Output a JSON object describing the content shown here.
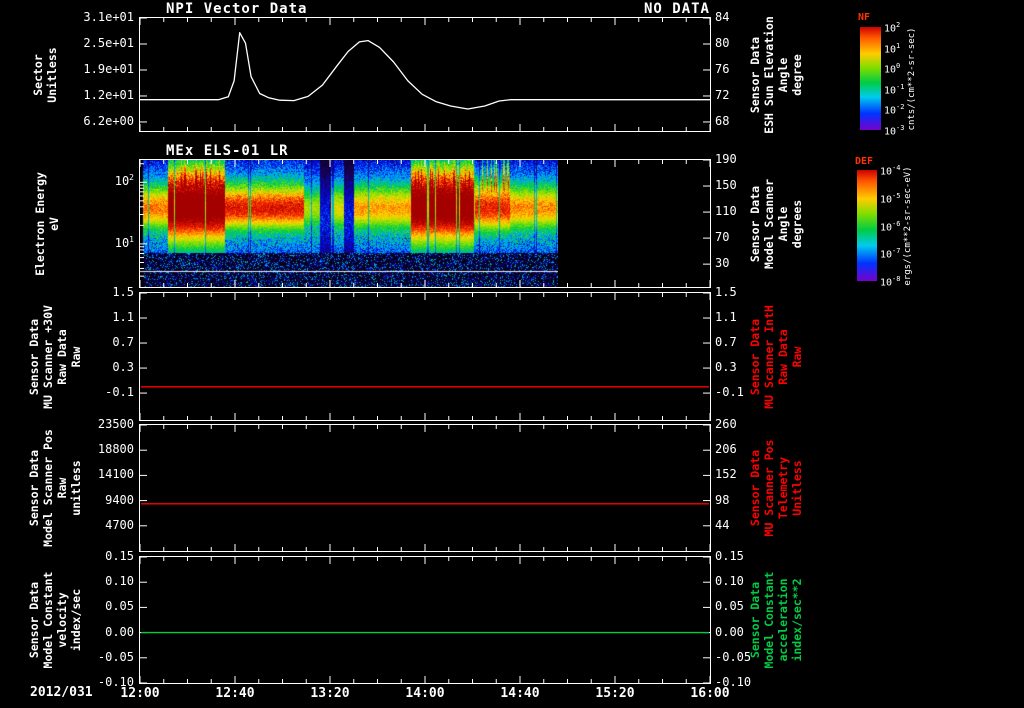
{
  "figure": {
    "date_label": "2012/031",
    "x_tick_labels": [
      "12:00",
      "12:40",
      "13:20",
      "14:00",
      "14:40",
      "15:20",
      "16:00"
    ],
    "x_range_hours": [
      12,
      16
    ],
    "background": "#000000",
    "axis_color": "#ffffff"
  },
  "titles": {
    "panel1_left": "NPI Vector Data",
    "panel1_right": "NO DATA",
    "panel2": "MEx ELS-01 LR"
  },
  "colorbars": [
    {
      "name": "NF",
      "units": "cnts/(cm**2-sr-sec)",
      "tick_exponents": [
        2,
        1,
        0,
        -1,
        -2,
        -3
      ]
    },
    {
      "name": "DEF",
      "units": "ergs/(cm**2-sr-sec-eV)",
      "tick_exponents": [
        -4,
        -5,
        -6,
        -7,
        -8
      ]
    }
  ],
  "panels": [
    {
      "left_title_lines": [
        "Sector",
        "Unitless"
      ],
      "right_title_lines": [
        "Sensor Data",
        "ESH Sun Elevation",
        "Angle",
        "degree"
      ],
      "right_title_color": "#ffffff",
      "tick_fracs": [
        0.0,
        0.23,
        0.46,
        0.69,
        0.92
      ],
      "left_tick_labels": [
        "3.1e+01",
        "2.5e+01",
        "1.9e+01",
        "1.2e+01",
        "6.2e+00"
      ],
      "right_tick_labels": [
        "84",
        "80",
        "76",
        "72",
        "68"
      ]
    },
    {
      "left_title_lines": [
        "Electron Energy",
        "eV"
      ],
      "right_title_lines": [
        "Sensor Data",
        "Model Scanner",
        "Angle",
        "degrees"
      ],
      "right_title_color": "#ffffff",
      "left_log_ticks": [
        {
          "exp": "2",
          "frac": 0.175
        },
        {
          "exp": "1",
          "frac": 0.66
        }
      ],
      "tick_fracs": [
        0.0,
        0.205,
        0.41,
        0.615,
        0.82
      ],
      "right_tick_labels": [
        "190",
        "150",
        "110",
        "70",
        "30"
      ]
    },
    {
      "left_title_lines": [
        "Sensor Data",
        "MU Scanner +30V",
        "Raw Data",
        "Raw"
      ],
      "right_title_lines": [
        "Sensor Data",
        "MU Scanner IntH",
        "Raw Data",
        "Raw"
      ],
      "right_title_color": "#ff0000",
      "tick_fracs": [
        0.0,
        0.197,
        0.394,
        0.591,
        0.788
      ],
      "left_tick_labels": [
        "1.5",
        "1.1",
        "0.7",
        "0.3",
        "-0.1"
      ],
      "right_tick_labels": [
        "1.5",
        "1.1",
        "0.7",
        "0.3",
        "-0.1"
      ]
    },
    {
      "left_title_lines": [
        "Sensor Data",
        "Model Scanner Pos",
        "Raw",
        "unitless"
      ],
      "right_title_lines": [
        "Sensor Data",
        "MU Scanner Pos",
        "Telemetry",
        "Unitless"
      ],
      "right_title_color": "#ff0000",
      "tick_fracs": [
        0.0,
        0.2,
        0.4,
        0.6,
        0.8
      ],
      "left_tick_labels": [
        "23500",
        "18800",
        "14100",
        "9400",
        "4700"
      ],
      "right_tick_labels": [
        "260",
        "206",
        "152",
        "98",
        "44"
      ]
    },
    {
      "left_title_lines": [
        "Sensor Data",
        "Model Constant",
        "velocity",
        "index/sec"
      ],
      "right_title_lines": [
        "Sensor Data",
        "Model Constant",
        "acceleration",
        "index/sec**2"
      ],
      "right_title_color": "#00cc44",
      "tick_fracs": [
        0.0,
        0.2,
        0.4,
        0.6,
        0.8,
        1.0
      ],
      "left_tick_labels": [
        "0.15",
        "0.10",
        "0.05",
        "0.00",
        "-0.05",
        "-0.10"
      ],
      "right_tick_labels": [
        "0.15",
        "0.10",
        "0.05",
        "0.00",
        "-0.05",
        "-0.10"
      ]
    }
  ],
  "chart_data": [
    {
      "type": "line",
      "title": "NPI Vector Data",
      "note": "NO DATA",
      "ylabel": "Sector Unitless",
      "ylabel_right": "Sensor Data ESH Sun Elevation Angle degree",
      "xlim_hours": [
        12,
        16
      ],
      "yticks_left": [
        31,
        24.8,
        18.6,
        12.4,
        6.2
      ],
      "yticks_right": [
        84,
        80,
        76,
        72,
        68
      ],
      "line_color": "#ffffff",
      "value_map": {
        "top_value": 31,
        "value_step": 6.2,
        "frac_step": 0.23
      },
      "points_t_value": [
        [
          12.0,
          11.5
        ],
        [
          12.55,
          11.5
        ],
        [
          12.62,
          12.2
        ],
        [
          12.66,
          16.0
        ],
        [
          12.7,
          27.5
        ],
        [
          12.74,
          25.0
        ],
        [
          12.78,
          17.0
        ],
        [
          12.84,
          13.0
        ],
        [
          12.9,
          12.0
        ],
        [
          12.98,
          11.4
        ],
        [
          13.08,
          11.3
        ],
        [
          13.18,
          12.3
        ],
        [
          13.28,
          15.0
        ],
        [
          13.38,
          19.5
        ],
        [
          13.46,
          23.0
        ],
        [
          13.54,
          25.3
        ],
        [
          13.6,
          25.6
        ],
        [
          13.68,
          24.0
        ],
        [
          13.78,
          20.5
        ],
        [
          13.88,
          16.0
        ],
        [
          13.98,
          12.8
        ],
        [
          14.08,
          11.0
        ],
        [
          14.18,
          10.0
        ],
        [
          14.3,
          9.3
        ],
        [
          14.42,
          10.0
        ],
        [
          14.52,
          11.2
        ],
        [
          14.6,
          11.5
        ],
        [
          16.0,
          11.5
        ]
      ]
    },
    {
      "type": "heatmap",
      "title": "MEx ELS-01 LR",
      "ylabel": "Electron Energy eV",
      "yscale": "log",
      "ylim": [
        2,
        230
      ],
      "xlim_hours": [
        12,
        16
      ],
      "data_extent_hours": [
        12.02,
        14.93
      ],
      "colorbar": "DEF",
      "band_center_log10_ev": 1.55,
      "white_line_frac": 0.88,
      "seed": 42,
      "segments": [
        {
          "t0": 12.02,
          "t1": 12.2,
          "amp": 0.72,
          "sigma": 0.3
        },
        {
          "t0": 12.2,
          "t1": 12.6,
          "amp": 1.0,
          "sigma": 0.5,
          "spiky": true
        },
        {
          "t0": 12.6,
          "t1": 13.15,
          "amp": 0.82,
          "sigma": 0.3
        },
        {
          "t0": 13.15,
          "t1": 13.26,
          "amp": 0.55,
          "sigma": 0.28
        },
        {
          "t0": 13.26,
          "t1": 13.34,
          "amp": 0.22,
          "sigma": 0.28
        },
        {
          "t0": 13.34,
          "t1": 13.43,
          "amp": 0.6,
          "sigma": 0.3
        },
        {
          "t0": 13.43,
          "t1": 13.5,
          "amp": 0.2,
          "sigma": 0.28
        },
        {
          "t0": 13.5,
          "t1": 13.9,
          "amp": 0.68,
          "sigma": 0.3
        },
        {
          "t0": 13.9,
          "t1": 14.35,
          "amp": 1.0,
          "sigma": 0.5,
          "spiky": true
        },
        {
          "t0": 14.35,
          "t1": 14.6,
          "amp": 0.8,
          "sigma": 0.33,
          "spiky": true
        },
        {
          "t0": 14.6,
          "t1": 14.93,
          "amp": 0.7,
          "sigma": 0.3
        }
      ]
    },
    {
      "type": "line",
      "ylabel": "Sensor Data MU Scanner +30V Raw Data Raw",
      "ylabel_right": "Sensor Data MU Scanner IntH Raw Data Raw",
      "xlim_hours": [
        12,
        16
      ],
      "constant_value": 0.0,
      "line_color": "#ff0000",
      "value_map": {
        "top_value": 1.5,
        "value_step": 0.4,
        "frac_step": 0.197
      }
    },
    {
      "type": "line",
      "ylabel": "Sensor Data Model Scanner Pos Raw unitless",
      "ylabel_right": "Sensor Data MU Scanner Pos Telemetry Unitless",
      "xlim_hours": [
        12,
        16
      ],
      "constant_value": 8800,
      "line_color": "#ff0000",
      "value_map": {
        "top_value": 23500,
        "value_step": 4700,
        "frac_step": 0.2
      }
    },
    {
      "type": "line",
      "ylabel": "Sensor Data Model Constant velocity index/sec",
      "ylabel_right": "Sensor Data Model Constant acceleration index/sec**2",
      "xlim_hours": [
        12,
        16
      ],
      "constant_value": 0.0,
      "line_color": "#00cc44",
      "value_map": {
        "top_value": 0.15,
        "value_step": 0.05,
        "frac_step": 0.2
      }
    }
  ]
}
